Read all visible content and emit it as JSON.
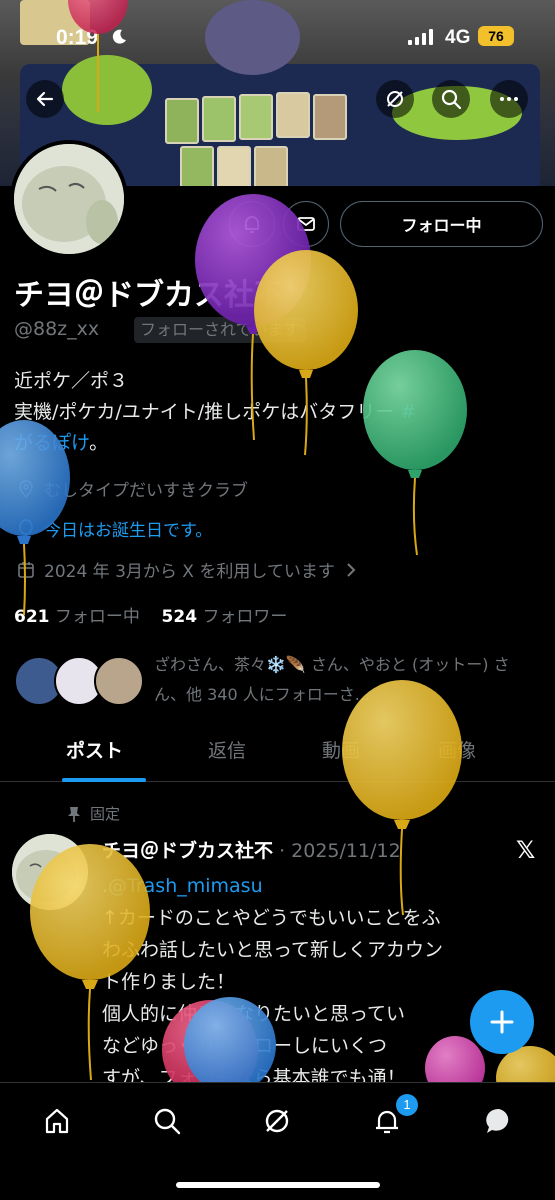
{
  "status_bar": {
    "time": "0:19",
    "network": "4G",
    "battery": "76"
  },
  "profile": {
    "follow_button": "フォロー中",
    "name": "チヨ＠ドブカス社不",
    "handle": "@88z_xx",
    "follows_you": "フォローされています",
    "bio_lines": [
      "近ポケ／ポ３",
      "実機/ポケカ/ユナイト/推しポケはバタフリー"
    ],
    "bio_hashtag_start": "#",
    "bio_hashtag_rest": "がるぽけ",
    "bio_end": "。",
    "location": "むしタイプだいすきクラブ",
    "birthday": "今日はお誕生日です。",
    "joined": "2024 年 3月から X を利用しています",
    "following_count": "621",
    "following_label": "フォロー中",
    "followers_count": "524",
    "followers_label": "フォロワー",
    "followed_by": "ざわさん、茶々❄️🪶 さん、やおと (オットー) さん、他 340 人にフォローさ..."
  },
  "tabs": [
    "ポスト",
    "返信",
    "動画",
    "画像"
  ],
  "pinned_post": {
    "pinned_label": "固定",
    "author": "チヨ＠ドブカス社不",
    "date": "· 2025/11/12",
    "mention": ".@Trash_mimasu",
    "lines": [
      "↑カードのことやどうでもいいことをふ",
      "わふわ話したいと思って新しくアカウン",
      "ト作りました！",
      "個人的に仲良くなりたいと思ってい",
      "などゆっくりフォローしにいくつ",
      "すが、フォローなら基本誰でも通！"
    ]
  },
  "notifications_badge": "1",
  "colors": {
    "accent": "#1d9bf0",
    "background": "#000000",
    "secondary_text": "#71767b"
  }
}
